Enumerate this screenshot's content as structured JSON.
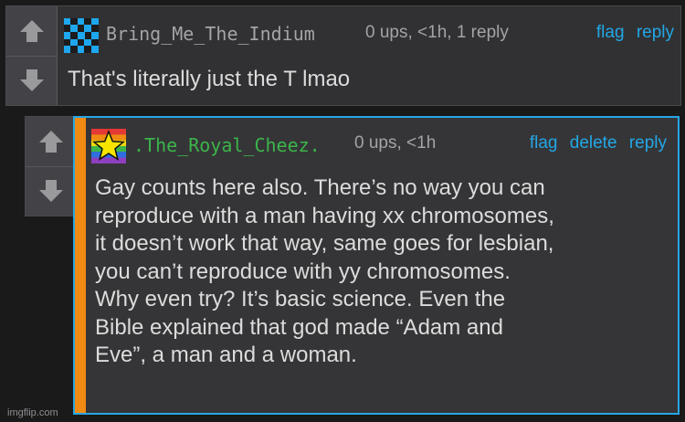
{
  "comment1": {
    "username": "Bring_Me_The_Indium",
    "meta": "0 ups, <1h, 1 reply",
    "actions": [
      "flag",
      "reply"
    ],
    "text": "That's literally just the T lmao",
    "avatar": "pixel-pattern-avatar",
    "username_color": "#a3a3a8"
  },
  "comment2": {
    "username": ".The_Royal_Cheez.",
    "meta": "0 ups, <1h",
    "actions": [
      "flag",
      "delete",
      "reply"
    ],
    "text_lines": [
      "Gay counts here also. There’s no way you can",
      "reproduce with a man having xx chromosomes,",
      "it doesn’t work that way, same goes for lesbian,",
      "you can’t reproduce with yy chromosomes.",
      "Why even try? It’s basic science. Even the",
      "Bible explained that god made “Adam and",
      "Eve”, a man and a woman."
    ],
    "avatar": "rainbow-star-avatar",
    "username_color": "#3bb54a",
    "highlight_color": "#27a6e5",
    "stripe_color": "#f08a12"
  },
  "watermark": "imgflip.com",
  "icons": {
    "upvote": "up-arrow-icon",
    "downvote": "down-arrow-icon"
  }
}
